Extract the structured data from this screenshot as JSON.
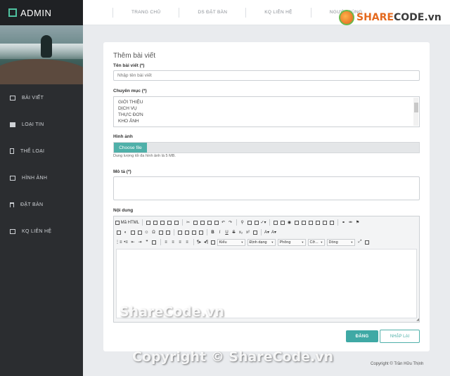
{
  "brand": {
    "title": "ADMIN"
  },
  "sidebar": {
    "items": [
      {
        "label": "BÀI VIẾT",
        "icon": "list-icon"
      },
      {
        "label": "LOẠI TIN",
        "icon": "tag-icon"
      },
      {
        "label": "THỂ LOẠI",
        "icon": "file-icon"
      },
      {
        "label": "HÌNH ẢNH",
        "icon": "image-icon"
      },
      {
        "label": "ĐẶT BÀN",
        "icon": "cutlery-icon"
      },
      {
        "label": "KQ LIÊN HỆ",
        "icon": "mail-icon"
      }
    ]
  },
  "topnav": {
    "items": [
      "TRANG CHỦ",
      "DS ĐẶT BÀN",
      "KQ LIÊN HỆ",
      "NGƯỜI DÙNG"
    ]
  },
  "watermark": {
    "logo_share": "SHARE",
    "logo_code": "CODE.vn",
    "mid": "ShareCode.vn",
    "bottom": "Copyright © ShareCode.vn"
  },
  "form": {
    "title": "Thêm bài viết",
    "title_label": "Tên bài viết (*)",
    "title_placeholder": "Nhập tên bài viết",
    "category_label": "Chuyên mục (*)",
    "categories": [
      "GIỚI THIỆU",
      "DỊCH VỤ",
      "THỰC ĐƠN",
      "KHO ẢNH"
    ],
    "image_label": "Hình ảnh",
    "file_button": "Choose file",
    "file_hint": "Dung lượng tối đa hình ảnh là 5 MB.",
    "desc_label": "Mô tả (*)",
    "content_label": "Nội dung",
    "editor": {
      "source_label": "Mã HTML",
      "format_label": "Kiểu",
      "heading_label": "Định dạng",
      "font_label": "Phông",
      "size_label": "Cỡ...",
      "style_label": "Dòng"
    },
    "submit_label": "ĐĂNG",
    "reset_label": "NHẬP LẠI"
  },
  "footer": {
    "copyright": "Copyright © Trần Hữu Thịnh"
  },
  "colors": {
    "accent": "#3fa9a5",
    "sidebar": "#2b2d30"
  }
}
